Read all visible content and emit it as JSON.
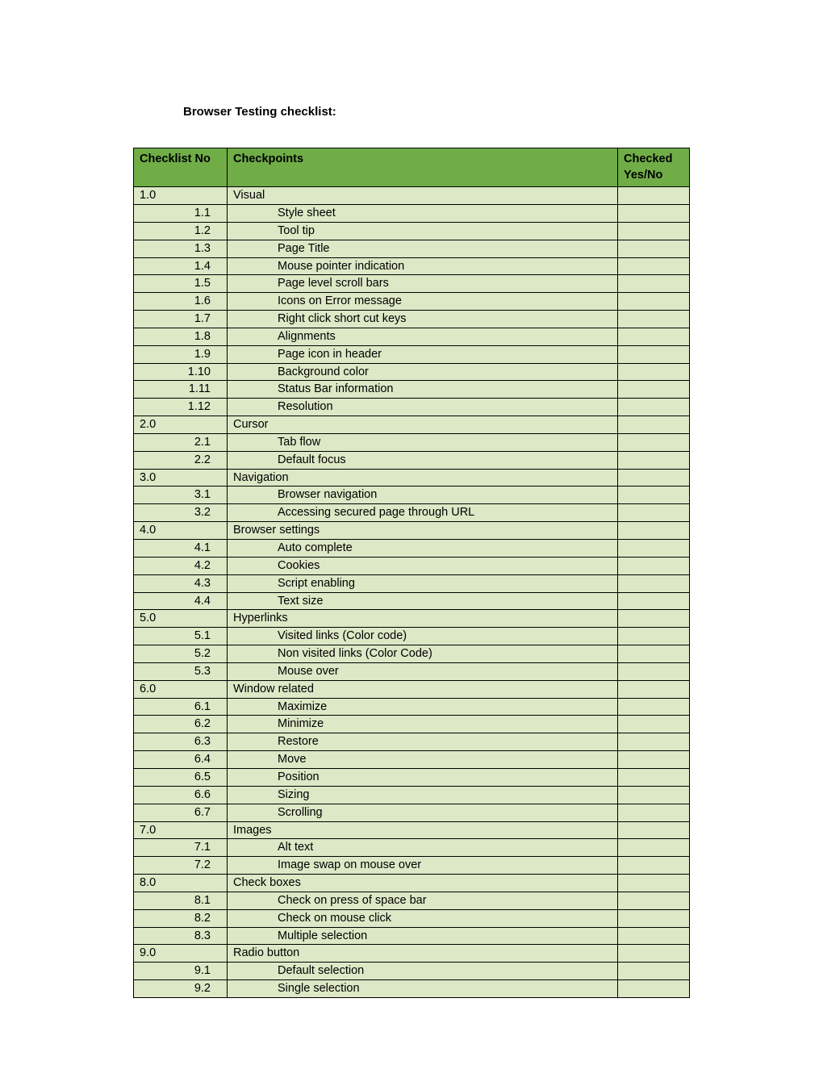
{
  "title": "Browser Testing checklist:",
  "columns": {
    "no": "Checklist No",
    "cp": "Checkpoints",
    "chk": "Checked Yes/No"
  },
  "rows": [
    {
      "no": "1.0",
      "label": "Visual",
      "level": 0
    },
    {
      "no": "1.1",
      "label": "Style sheet",
      "level": 1
    },
    {
      "no": "1.2",
      "label": "Tool tip",
      "level": 1
    },
    {
      "no": "1.3",
      "label": "Page Title",
      "level": 1
    },
    {
      "no": "1.4",
      "label": "Mouse pointer indication",
      "level": 1
    },
    {
      "no": "1.5",
      "label": "Page level scroll bars",
      "level": 1
    },
    {
      "no": "1.6",
      "label": "Icons on Error message",
      "level": 1
    },
    {
      "no": "1.7",
      "label": "Right click short cut keys",
      "level": 1
    },
    {
      "no": "1.8",
      "label": "Alignments",
      "level": 1
    },
    {
      "no": "1.9",
      "label": "Page icon in header",
      "level": 1
    },
    {
      "no": "1.10",
      "label": "Background color",
      "level": 1
    },
    {
      "no": "1.11",
      "label": "Status Bar information",
      "level": 1
    },
    {
      "no": "1.12",
      "label": "Resolution",
      "level": 1
    },
    {
      "no": "2.0",
      "label": "Cursor",
      "level": 0
    },
    {
      "no": "2.1",
      "label": "Tab flow",
      "level": 1
    },
    {
      "no": "2.2",
      "label": "Default focus",
      "level": 1
    },
    {
      "no": "3.0",
      "label": "Navigation",
      "level": 0
    },
    {
      "no": "3.1",
      "label": "Browser navigation",
      "level": 1
    },
    {
      "no": "3.2",
      "label": "Accessing secured page through URL",
      "level": 1
    },
    {
      "no": "4.0",
      "label": "Browser settings",
      "level": 0
    },
    {
      "no": "4.1",
      "label": "Auto complete",
      "level": 1
    },
    {
      "no": "4.2",
      "label": "Cookies",
      "level": 1
    },
    {
      "no": "4.3",
      "label": "Script enabling",
      "level": 1
    },
    {
      "no": "4.4",
      "label": "Text size",
      "level": 1
    },
    {
      "no": "5.0",
      "label": "Hyperlinks",
      "level": 0
    },
    {
      "no": "5.1",
      "label": "Visited links (Color code)",
      "level": 1
    },
    {
      "no": "5.2",
      "label": "Non visited links (Color Code)",
      "level": 1
    },
    {
      "no": "5.3",
      "label": "Mouse over",
      "level": 1
    },
    {
      "no": "6.0",
      "label": "Window related",
      "level": 0
    },
    {
      "no": "6.1",
      "label": "Maximize",
      "level": 1
    },
    {
      "no": "6.2",
      "label": "Minimize",
      "level": 1
    },
    {
      "no": "6.3",
      "label": "Restore",
      "level": 1
    },
    {
      "no": "6.4",
      "label": "Move",
      "level": 1
    },
    {
      "no": "6.5",
      "label": "Position",
      "level": 1
    },
    {
      "no": "6.6",
      "label": "Sizing",
      "level": 1
    },
    {
      "no": "6.7",
      "label": "Scrolling",
      "level": 1
    },
    {
      "no": "7.0",
      "label": "Images",
      "level": 0
    },
    {
      "no": "7.1",
      "label": "Alt text",
      "level": 1
    },
    {
      "no": "7.2",
      "label": "Image swap on mouse over",
      "level": 1
    },
    {
      "no": "8.0",
      "label": "Check boxes",
      "level": 0
    },
    {
      "no": "8.1",
      "label": "Check on press of space bar",
      "level": 1
    },
    {
      "no": "8.2",
      "label": "Check on mouse click",
      "level": 1
    },
    {
      "no": "8.3",
      "label": "Multiple selection",
      "level": 1
    },
    {
      "no": "9.0",
      "label": "Radio button",
      "level": 0
    },
    {
      "no": "9.1",
      "label": "Default selection",
      "level": 1
    },
    {
      "no": "9.2",
      "label": "Single selection",
      "level": 1
    }
  ]
}
